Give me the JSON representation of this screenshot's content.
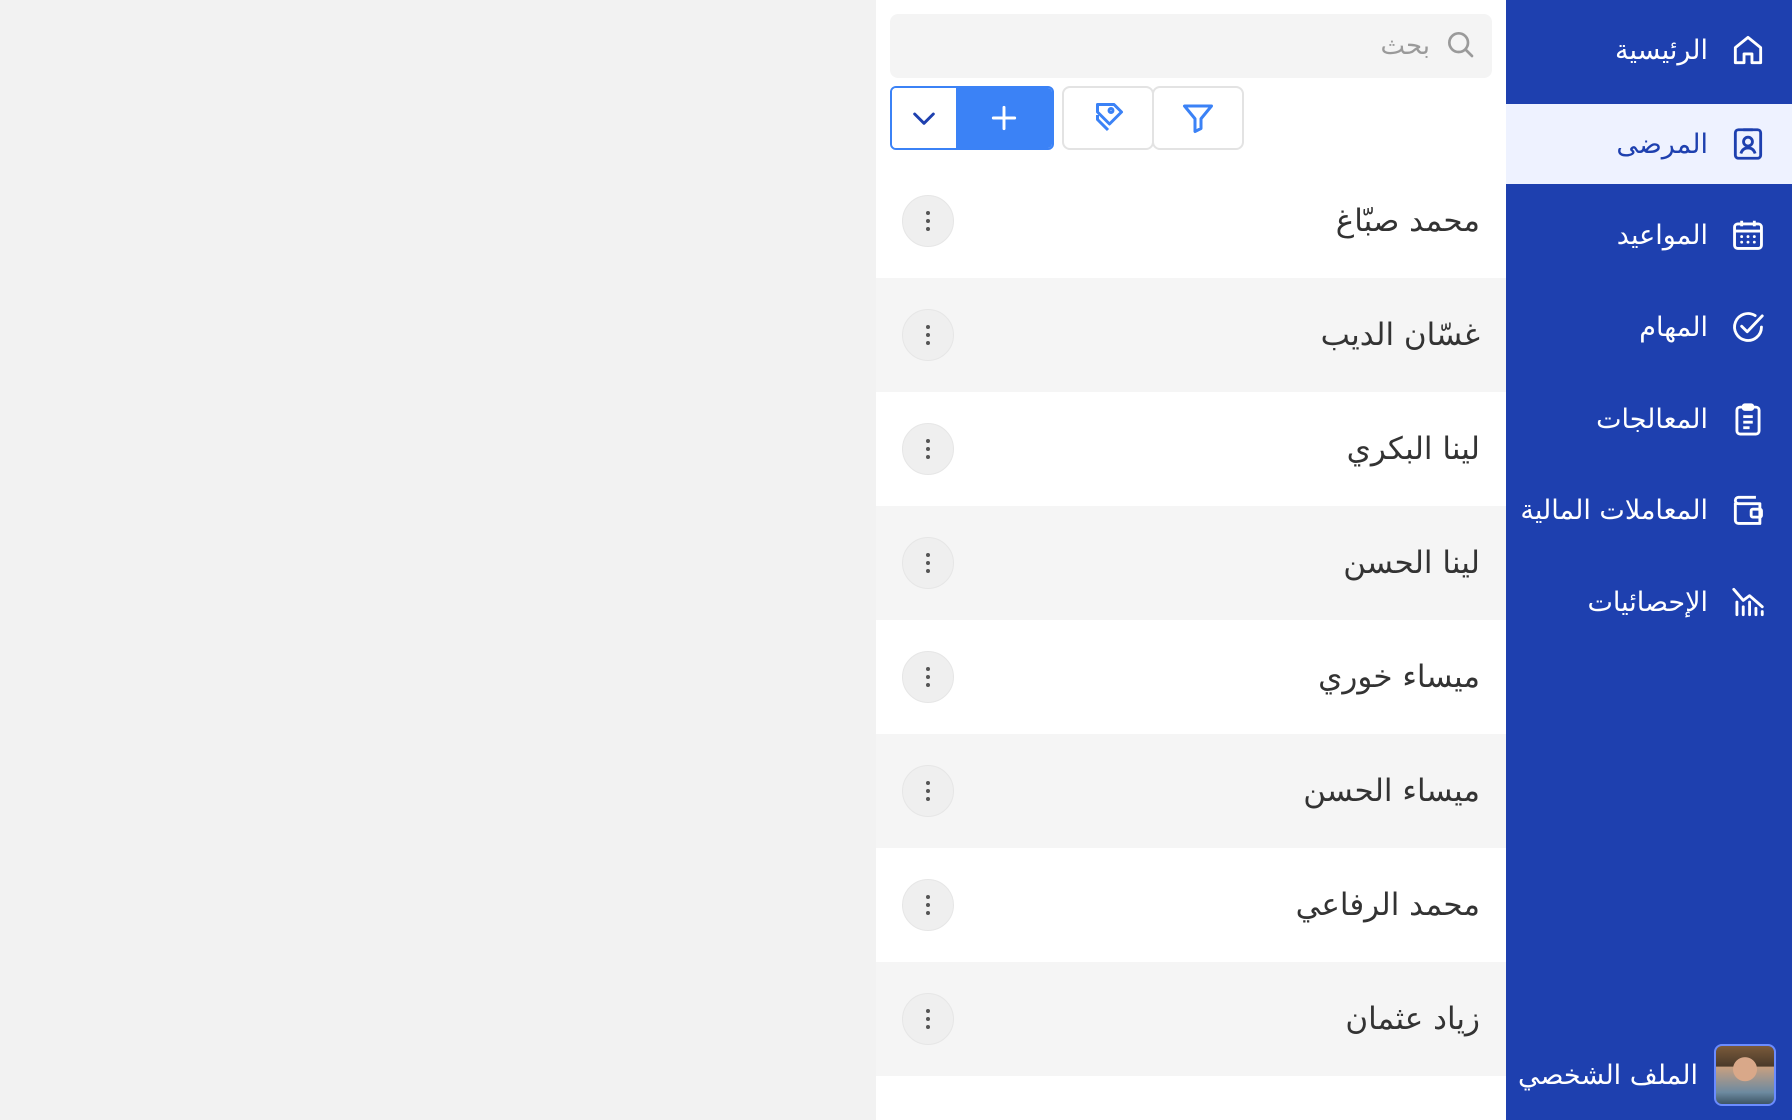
{
  "sidebar": {
    "items": [
      {
        "label": "الرئيسية",
        "icon": "home-icon",
        "active": false
      },
      {
        "label": "المرضى",
        "icon": "patient-id-icon",
        "active": true
      },
      {
        "label": "المواعيد",
        "icon": "calendar-icon",
        "active": false
      },
      {
        "label": "المهام",
        "icon": "check-circle-icon",
        "active": false
      },
      {
        "label": "المعالجات",
        "icon": "clipboard-icon",
        "active": false
      },
      {
        "label": "المعاملات المالية",
        "icon": "wallet-icon",
        "active": false
      },
      {
        "label": "الإحصائيات",
        "icon": "chart-icon",
        "active": false
      }
    ],
    "profile": {
      "label": "الملف الشخصي",
      "icon": "avatar"
    }
  },
  "search": {
    "placeholder": "بحث",
    "value": ""
  },
  "toolbar": {
    "filter_icon": "filter-icon",
    "tags_icon": "tags-icon",
    "add_icon": "plus-icon",
    "dropdown_icon": "chevron-down-icon"
  },
  "patients": [
    {
      "name": "محمد صبّاغ"
    },
    {
      "name": "غسّان الديب"
    },
    {
      "name": "لينا البكري"
    },
    {
      "name": "لينا الحسن"
    },
    {
      "name": "ميساء خوري"
    },
    {
      "name": "ميساء الحسن"
    },
    {
      "name": "محمد الرفاعي"
    },
    {
      "name": "زياد عثمان"
    }
  ],
  "colors": {
    "sidebar_bg": "#1e40af",
    "active_bg": "#eef2ff",
    "accent": "#3b82f6",
    "page_bg": "#f2f2f2"
  }
}
